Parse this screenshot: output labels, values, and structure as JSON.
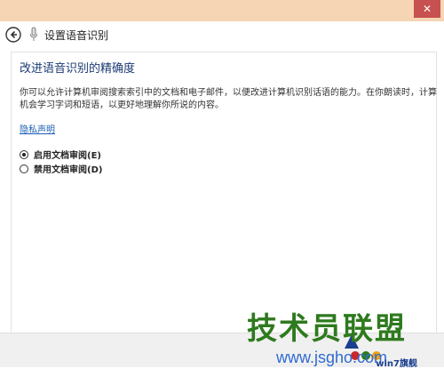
{
  "window": {
    "close_symbol": "✕"
  },
  "nav": {
    "title": "设置语音识别"
  },
  "main": {
    "heading": "改进语音识别的精确度",
    "description": "你可以允许计算机审阅搜索索引中的文档和电子邮件，以便改进计算机识别话语的能力。在你朗读时，计算机会学习字词和短语，以更好地理解你所说的内容。",
    "privacy_link": "隐私声明",
    "options": [
      {
        "label": "启用文档审阅(E)",
        "selected": true
      },
      {
        "label": "禁用文档审阅(D)",
        "selected": false
      }
    ]
  },
  "watermark": {
    "cn": "技术员联盟",
    "url": "www.jsgho.com",
    "logo_text": "win7旗舰"
  }
}
